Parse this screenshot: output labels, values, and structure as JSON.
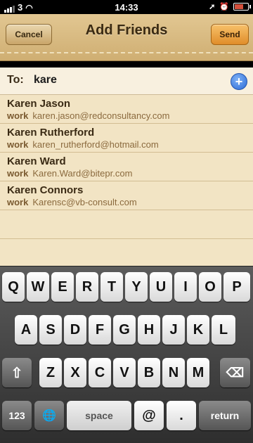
{
  "status_bar": {
    "carrier": "3",
    "time": "14:33"
  },
  "nav": {
    "cancel_label": "Cancel",
    "title": "Add Friends",
    "send_label": "Send"
  },
  "to_field": {
    "label": "To:",
    "value": "kare"
  },
  "suggestions": [
    {
      "name": "Karen Jason",
      "type": "work",
      "email": "karen.jason@redconsultancy.com"
    },
    {
      "name": "Karen Rutherford",
      "type": "work",
      "email": "karen_rutherford@hotmail.com"
    },
    {
      "name": "Karen Ward",
      "type": "work",
      "email": "Karen.Ward@bitepr.com"
    },
    {
      "name": "Karen Connors",
      "type": "work",
      "email": "Karensc@vb-consult.com"
    }
  ],
  "keyboard": {
    "row1": [
      "Q",
      "W",
      "E",
      "R",
      "T",
      "Y",
      "U",
      "I",
      "O",
      "P"
    ],
    "row2": [
      "A",
      "S",
      "D",
      "F",
      "G",
      "H",
      "J",
      "K",
      "L"
    ],
    "row3": [
      "Z",
      "X",
      "C",
      "V",
      "B",
      "N",
      "M"
    ],
    "numbers_label": "123",
    "space_label": "space",
    "at_label": "@",
    "dot_label": ".",
    "return_label": "return",
    "shift_icon": "⇧",
    "backspace_icon": "⌫",
    "globe_icon": "🌐"
  },
  "icons": {
    "add_contact": "plus-circle-icon"
  },
  "colors": {
    "send_button": "#e08d2a",
    "add_contact": "#2c6ad7"
  }
}
